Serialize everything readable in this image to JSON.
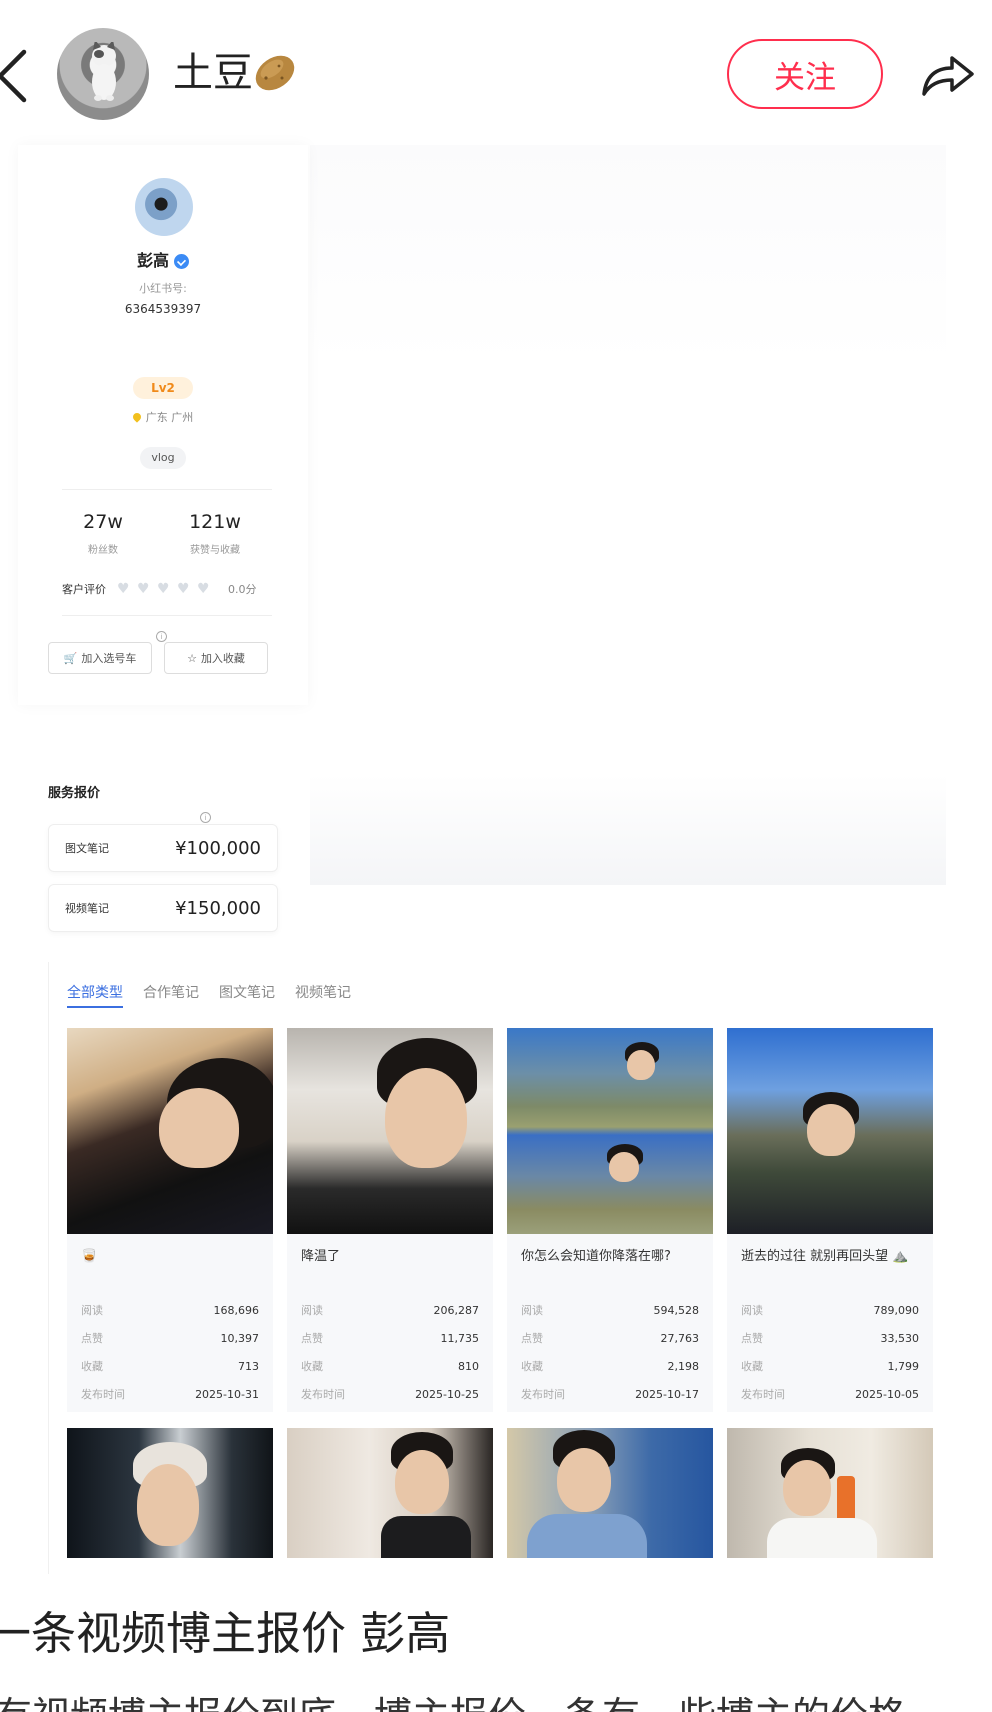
{
  "header": {
    "username": "土豆",
    "follow_label": "关注",
    "back_icon": "chevron-left-icon",
    "share_icon": "share-icon",
    "username_emoji_icon": "potato-icon"
  },
  "profile": {
    "name": "彭高",
    "id_label": "小红书号:",
    "id_value": "6364539397",
    "level": "Lv2",
    "location": "广东 广州",
    "tag": "vlog",
    "followers_value": "27w",
    "followers_label": "粉丝数",
    "likes_value": "121w",
    "likes_label": "获赞与收藏",
    "rating_label": "客户评价",
    "rating_score": "0.0分",
    "rating_hearts": 5,
    "add_cart_label": "加入选号车",
    "add_fav_label": "加入收藏"
  },
  "services": {
    "title": "服务报价",
    "items": [
      {
        "label": "图文笔记",
        "price": "¥100,000"
      },
      {
        "label": "视频笔记",
        "price": "¥150,000"
      }
    ]
  },
  "notes": {
    "tabs": [
      "全部类型",
      "合作笔记",
      "图文笔记",
      "视频笔记"
    ],
    "active_tab": "全部类型",
    "row_labels": {
      "read": "阅读",
      "like": "点赞",
      "fav": "收藏",
      "date": "发布时间"
    },
    "cards": [
      {
        "title": "🥃",
        "read": "168,696",
        "like": "10,397",
        "fav": "713",
        "date": "2025-10-31"
      },
      {
        "title": "降温了",
        "read": "206,287",
        "like": "11,735",
        "fav": "810",
        "date": "2025-10-25"
      },
      {
        "title": "你怎么会知道你降落在哪?",
        "read": "594,528",
        "like": "27,763",
        "fav": "2,198",
        "date": "2025-10-17"
      },
      {
        "title": "逝去的过往 就别再回头望 ⛰️",
        "read": "789,090",
        "like": "33,530",
        "fav": "1,799",
        "date": "2025-10-05"
      }
    ]
  },
  "caption": {
    "title": "一条视频博主报价 彭高",
    "subtitle": "有视频博主报价到底一博主报价一条有一些博主的价格"
  },
  "colors": {
    "accent": "#ff2e4d",
    "link_blue": "#3b6fe0",
    "level_orange": "#f08a1a"
  }
}
